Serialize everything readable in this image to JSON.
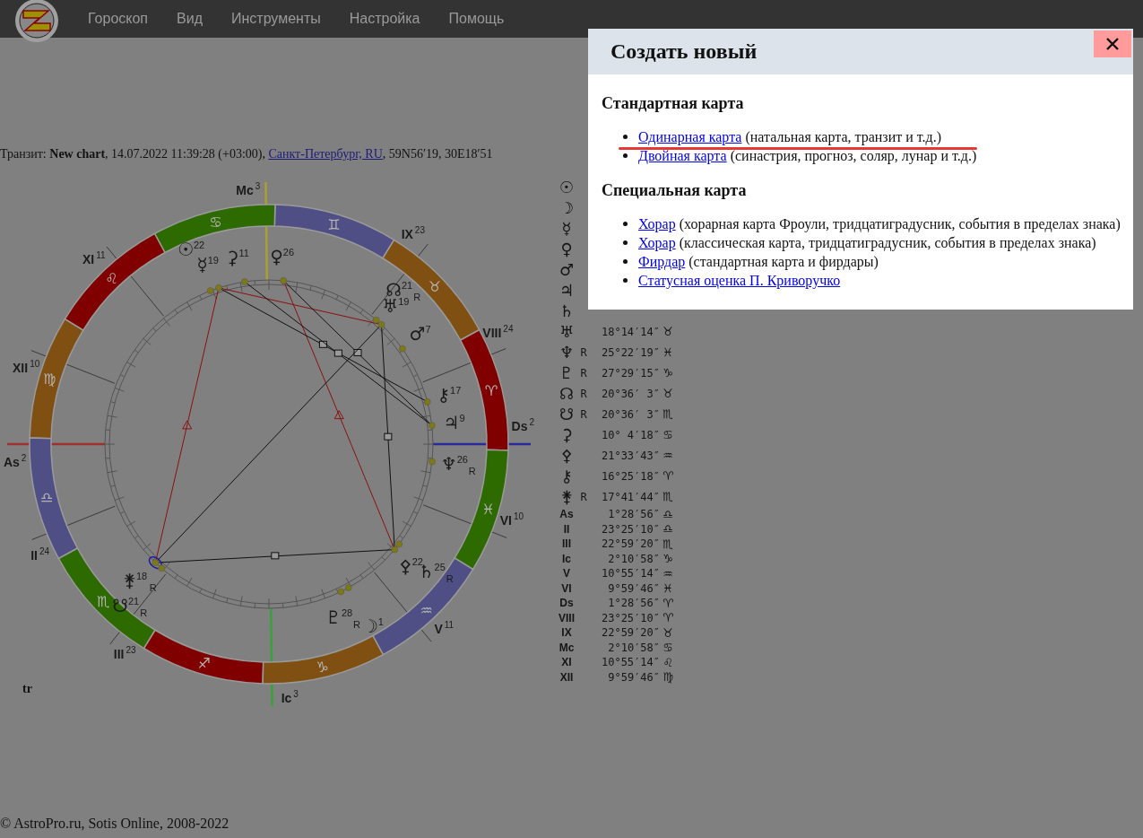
{
  "menu": [
    "Гороскоп",
    "Вид",
    "Инструменты",
    "Настройка",
    "Помощь"
  ],
  "transit_line": {
    "prefix": "Транзит: **New chart**, 14.07.2022 11:39:28 (+03:00), ",
    "place_link": "Санкт-Петербург, RU",
    "suffix": ", 59N56′19, 30E18′51"
  },
  "chart": {
    "signs": [
      {
        "glyph": "♈",
        "color": "#800000"
      },
      {
        "glyph": "♉",
        "color": "#7f5012"
      },
      {
        "glyph": "♊",
        "color": "#4f4f86"
      },
      {
        "glyph": "♋",
        "color": "#2d6a00"
      },
      {
        "glyph": "♌",
        "color": "#800000"
      },
      {
        "glyph": "♍",
        "color": "#7f5012"
      },
      {
        "glyph": "♎",
        "color": "#4f4f86"
      },
      {
        "glyph": "♏",
        "color": "#2d6a00"
      },
      {
        "glyph": "♐",
        "color": "#800000"
      },
      {
        "glyph": "♑",
        "color": "#7f5012"
      },
      {
        "glyph": "♒",
        "color": "#4f4f86"
      },
      {
        "glyph": "♓",
        "color": "#2d6a00"
      }
    ],
    "houses": [
      {
        "label": "As",
        "degree": "2",
        "color": "#a03030"
      },
      {
        "label": "II",
        "degree": "24"
      },
      {
        "label": "III",
        "degree": "23"
      },
      {
        "label": "Ic",
        "degree": "3",
        "color": "#3aa03a"
      },
      {
        "label": "V",
        "degree": "11"
      },
      {
        "label": "VI",
        "degree": "10"
      },
      {
        "label": "Ds",
        "degree": "2",
        "color": "#2a2aa0"
      },
      {
        "label": "VIII",
        "degree": "24"
      },
      {
        "label": "IX",
        "degree": "23"
      },
      {
        "label": "Mc",
        "degree": "3",
        "color": "#a8a030"
      },
      {
        "label": "XI",
        "degree": "11"
      },
      {
        "label": "XII",
        "degree": "10"
      }
    ],
    "planets": [
      {
        "glyph": "☉",
        "degree": "22"
      },
      {
        "glyph": "☽",
        "degree": "1"
      },
      {
        "glyph": "☿",
        "degree": "19"
      },
      {
        "glyph": "♀",
        "degree": "26"
      },
      {
        "glyph": "♂",
        "degree": "7"
      },
      {
        "glyph": "♃",
        "degree": "9"
      },
      {
        "glyph": "♄",
        "degree": "25",
        "retro": "R"
      },
      {
        "glyph": "♅",
        "degree": "19"
      },
      {
        "glyph": "♆",
        "degree": "26",
        "retro": "R"
      },
      {
        "glyph": "♇",
        "degree": "28",
        "retro": "R"
      },
      {
        "glyph": "☊",
        "degree": "21",
        "retro": "R"
      },
      {
        "glyph": "☋",
        "degree": "21",
        "retro": "R"
      },
      {
        "glyph": "⚳",
        "degree": "11"
      },
      {
        "glyph": "⚴",
        "degree": "22"
      },
      {
        "glyph": "⚷",
        "degree": "17"
      },
      {
        "glyph": "⚵",
        "degree": "18",
        "retro": "R"
      }
    ],
    "corner_label": "tr"
  },
  "positions": [
    {
      "kind": "planet",
      "glyph": "☉"
    },
    {
      "kind": "planet",
      "glyph": "☽"
    },
    {
      "kind": "planet",
      "glyph": "☿"
    },
    {
      "kind": "planet",
      "glyph": "♀"
    },
    {
      "kind": "planet",
      "glyph": "♂"
    },
    {
      "kind": "planet",
      "glyph": "♃"
    },
    {
      "kind": "planet",
      "glyph": "♄"
    },
    {
      "kind": "planet",
      "glyph": "♅",
      "position": "18°14′14″",
      "sign": "♉"
    },
    {
      "kind": "planet",
      "glyph": "♆",
      "retro": "R",
      "position": "25°22′19″",
      "sign": "♓"
    },
    {
      "kind": "planet",
      "glyph": "♇",
      "retro": "R",
      "position": "27°29′15″",
      "sign": "♑"
    },
    {
      "kind": "planet",
      "glyph": "☊",
      "retro": "R",
      "position": "20°36′ 3″",
      "sign": "♉"
    },
    {
      "kind": "planet",
      "glyph": "☋",
      "retro": "R",
      "position": "20°36′ 3″",
      "sign": "♏"
    },
    {
      "kind": "planet",
      "glyph": "⚳",
      "position": "10° 4′18″",
      "sign": "♋"
    },
    {
      "kind": "planet",
      "glyph": "⚴",
      "position": "21°33′43″",
      "sign": "♒"
    },
    {
      "kind": "planet",
      "glyph": "⚷",
      "position": "16°25′18″",
      "sign": "♈"
    },
    {
      "kind": "planet",
      "glyph": "⚵",
      "retro": "R",
      "position": "17°41′44″",
      "sign": "♏"
    },
    {
      "kind": "house",
      "glyph": "As",
      "position": "1°28′56″",
      "sign": "♎"
    },
    {
      "kind": "house",
      "glyph": "II",
      "position": "23°25′10″",
      "sign": "♎"
    },
    {
      "kind": "house",
      "glyph": "III",
      "position": "22°59′20″",
      "sign": "♏"
    },
    {
      "kind": "house",
      "glyph": "Ic",
      "position": "2°10′58″",
      "sign": "♑"
    },
    {
      "kind": "house",
      "glyph": "V",
      "position": "10°55′14″",
      "sign": "♒"
    },
    {
      "kind": "house",
      "glyph": "VI",
      "position": "9°59′46″",
      "sign": "♓"
    },
    {
      "kind": "house",
      "glyph": "Ds",
      "position": "1°28′56″",
      "sign": "♈"
    },
    {
      "kind": "house",
      "glyph": "VIII",
      "position": "23°25′10″",
      "sign": "♈"
    },
    {
      "kind": "house",
      "glyph": "IX",
      "position": "22°59′20″",
      "sign": "♉"
    },
    {
      "kind": "house",
      "glyph": "Mc",
      "position": "2°10′58″",
      "sign": "♋"
    },
    {
      "kind": "house",
      "glyph": "XI",
      "position": "10°55′14″",
      "sign": "♌"
    },
    {
      "kind": "house",
      "glyph": "XII",
      "position": "9°59′46″",
      "sign": "♍"
    }
  ],
  "footer": "© AstroPro.ru, Sotis Online, 2008-2022",
  "dialog": {
    "title": "Создать новый",
    "sections": [
      {
        "heading": "Стандартная карта",
        "items": [
          {
            "link": "Одинарная карта",
            "note": " (натальная карта, транзит и т.д.)",
            "marked": true
          },
          {
            "link": "Двойная карта",
            "note": " (синастрия, прогноз, соляр, лунар и т.д.)",
            "marked": false
          }
        ]
      },
      {
        "heading": "Специальная карта",
        "items": [
          {
            "link": "Хорар",
            "note": " (хорарная карта Фроули, тридцатиградусник, события в пределах знака)",
            "marked": false
          },
          {
            "link": "Хорар",
            "note": " (классическая карта, тридцатиградусник, события в пределах знака)",
            "marked": false
          },
          {
            "link": "Фирдар",
            "note": " (стандартная карта и фирдары)",
            "marked": false
          },
          {
            "link": "Статусная оценка П. Криворучко",
            "marked": false
          }
        ]
      }
    ]
  }
}
